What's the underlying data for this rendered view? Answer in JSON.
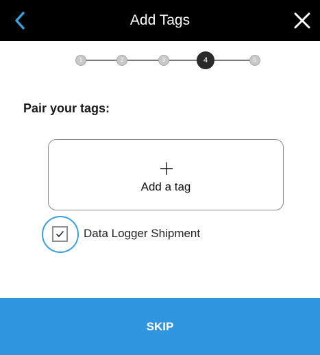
{
  "header": {
    "title": "Add Tags",
    "back_icon": "chevron-left-icon",
    "close_icon": "close-icon",
    "accent_color": "#3aa0dc"
  },
  "stepper": {
    "steps": [
      "1",
      "2",
      "3",
      "4",
      "5"
    ],
    "current_step": 4
  },
  "main": {
    "heading": "Pair your tags:",
    "add_tag": {
      "icon": "plus-icon",
      "label": "Add a tag"
    },
    "option": {
      "label": "Data Logger Shipment",
      "checked": true
    }
  },
  "footer": {
    "skip_label": "SKIP",
    "button_color": "#2f95de"
  }
}
